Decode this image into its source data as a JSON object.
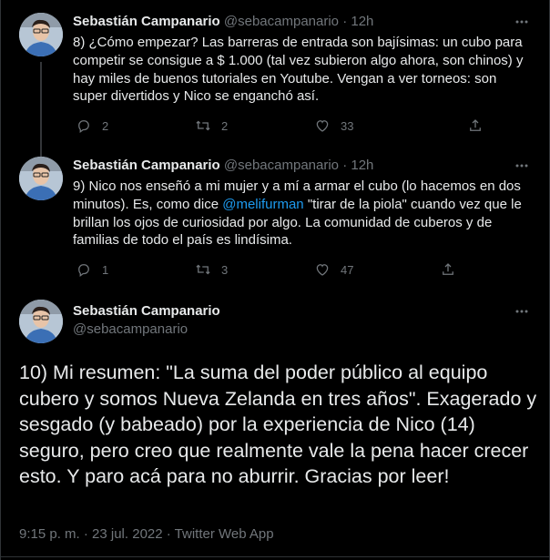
{
  "tweets": [
    {
      "name": "Sebastián Campanario",
      "handle": "@sebacampanario",
      "time": "· 12h",
      "text": "8) ¿Cómo empezar? Las barreras de entrada son bajísimas: un cubo para competir se consigue a $ 1.000 (tal vez subieron algo ahora, son chinos) y hay miles de buenos tutoriales en Youtube. Vengan a ver torneos: son super divertidos y Nico se enganchó así.",
      "replies": "2",
      "retweets": "2",
      "likes": "33"
    },
    {
      "name": "Sebastián Campanario",
      "handle": "@sebacampanario",
      "time": "· 12h",
      "text_before": "9) Nico nos enseñó a mi mujer y a mí a armar el cubo (lo hacemos en dos minutos). Es, como dice ",
      "mention": "@melifurman",
      "text_after": " \"tirar de la piola\" cuando vez que le brillan los ojos de curiosidad por algo. La comunidad de cuberos y de familias de todo el país es lindísima.",
      "replies": "1",
      "retweets": "3",
      "likes": "47"
    }
  ],
  "main_tweet": {
    "name": "Sebastián Campanario",
    "handle": "@sebacampanario",
    "text": "10) Mi resumen: \"La suma del poder público al equipo cubero y somos Nueva Zelanda en tres años\". Exagerado y sesgado (y babeado) por la experiencia de Nico (14) seguro, pero creo que realmente vale la pena hacer crecer esto. Y paro acá para no aburrir. Gracias por leer!",
    "meta": "9:15 p. m. · 23 jul. 2022 · Twitter Web App"
  },
  "colors": {
    "background": "#000000",
    "text": "#e7e9ea",
    "secondary": "#71767b",
    "link": "#1d9bf0",
    "divider": "#2f3336"
  },
  "icons": [
    "more-icon",
    "reply-icon",
    "retweet-icon",
    "like-icon",
    "share-icon"
  ]
}
